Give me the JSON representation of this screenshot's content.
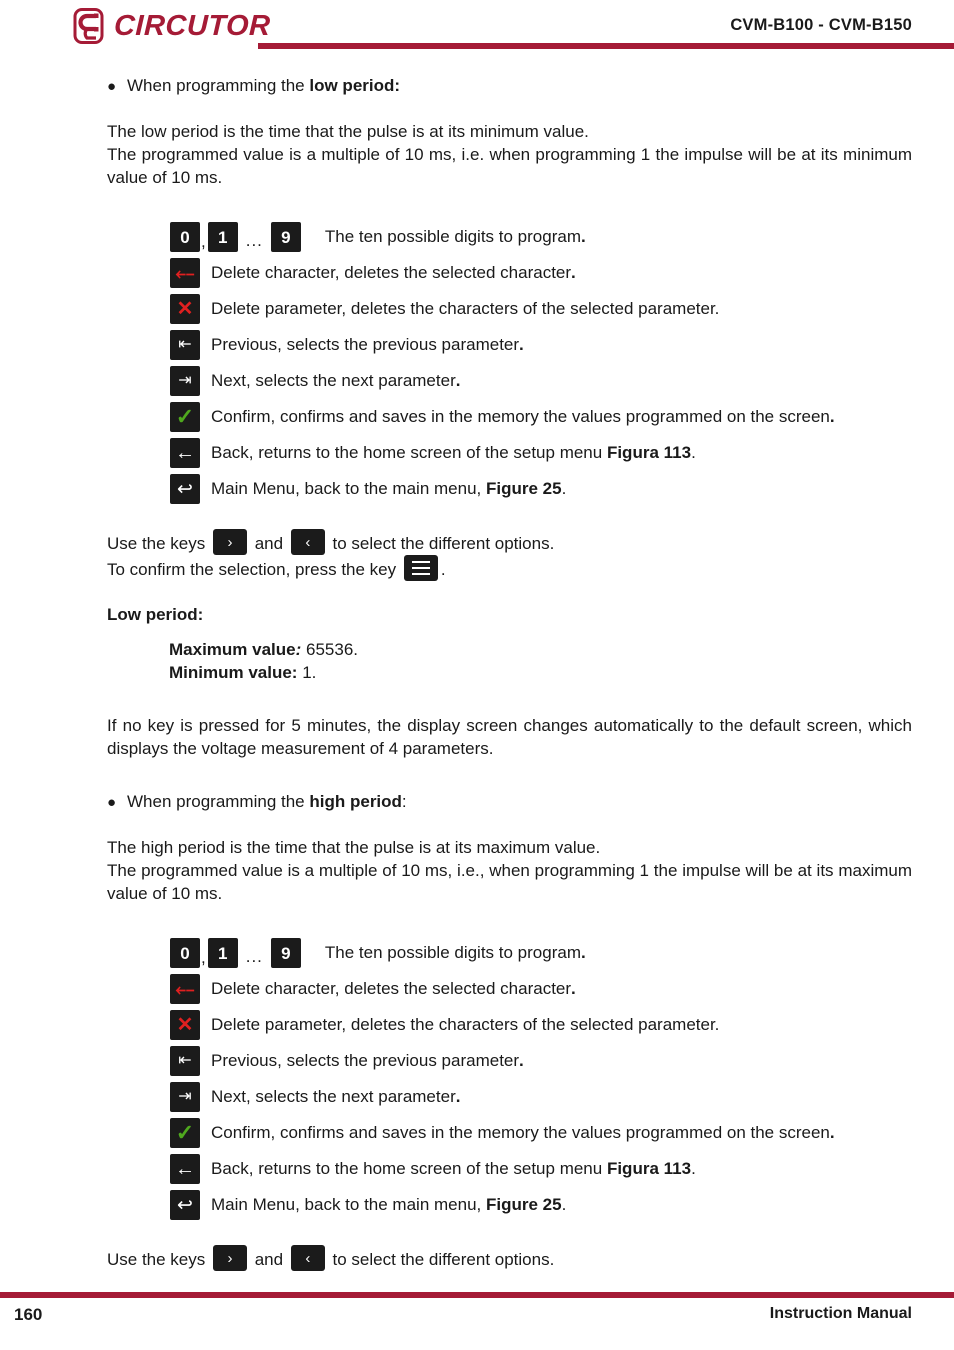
{
  "header": {
    "logo_text": "CIRCUTOR",
    "logo_icon": "circutor-c-logo",
    "title": "CVM-B100 - CVM-B150",
    "rule_color": "#A51B36"
  },
  "footer": {
    "page_number": "160",
    "label": "Instruction Manual",
    "rule_color": "#A51B36"
  },
  "sections": {
    "low": {
      "bullet": "When programming the ",
      "bullet_bold": "low period:",
      "para1": "The low period is the time that the pulse is at its minimum value.",
      "para2": "The programmed value is a multiple of 10 ms, i.e. when programming 1 the impulse will be at its minimum value of 10 ms.",
      "keys": {
        "digit_0": "0",
        "digit_1": "1",
        "digit_9": "9",
        "comma": ",",
        "ellipsis": "...",
        "digits_desc": "The ten possible digits to program",
        "digits_desc_end": ".",
        "del_char_icon": "delete-character-icon",
        "del_char_desc": "Delete character, deletes the selected character",
        "del_char_desc_end": ".",
        "del_param_icon": "delete-parameter-icon",
        "del_param_desc": "Delete parameter, deletes the characters of the selected parameter.",
        "prev_icon": "previous-parameter-icon",
        "prev_desc": "Previous, selects the previous parameter",
        "prev_desc_end": ".",
        "next_icon": "next-parameter-icon",
        "next_desc": "Next, selects the next parameter",
        "next_desc_end": ".",
        "confirm_icon": "confirm-checkmark-icon",
        "confirm_desc": "Confirm, confirms and saves in the memory the values programmed on the screen",
        "confirm_desc_end": ".",
        "back_icon": "back-arrow-icon",
        "back_desc": "Back, returns to the home screen of the setup menu ",
        "back_ref": "Figura 113",
        "back_desc_end": ".",
        "main_icon": "main-menu-return-icon",
        "main_desc": "Main Menu, back to the main menu, ",
        "main_ref": "Figure 25",
        "main_desc_end": "."
      },
      "usekeys": {
        "prefix": "Use the keys ",
        "right_icon": "chevron-right-key-icon",
        "middle": " and ",
        "left_icon": "chevron-left-key-icon",
        "suffix": " to select the different options.",
        "confirm_prefix": "To confirm the selection, press the key ",
        "menu_icon": "menu-hamburger-key-icon",
        "confirm_suffix": "."
      },
      "title": "Low period:",
      "maximum_label": "Maximum value",
      "maximum_colon": ":",
      "maximum_value": " 65536.",
      "minimum_label": "Minimum value:",
      "minimum_value": " 1."
    },
    "timeout_para": "If no key is pressed for 5 minutes, the display screen changes automatically to the default screen, which displays the voltage measurement of 4 parameters.",
    "high": {
      "bullet": "When programming the ",
      "bullet_bold": "high period",
      "bullet_end": ":",
      "para1": "The high period is the time that the pulse is at its maximum value.",
      "para2": "The programmed value is a multiple of 10 ms, i.e., when programming 1 the impulse will be at its maximum value of 10 ms.",
      "keys": {
        "digit_0": "0",
        "digit_1": "1",
        "digit_9": "9",
        "comma": ",",
        "ellipsis": "...",
        "digits_desc": "The ten possible digits to program",
        "digits_desc_end": ".",
        "del_char_desc": "Delete character, deletes the selected character",
        "del_char_desc_end": ".",
        "del_param_desc": "Delete parameter, deletes the characters of the selected parameter.",
        "prev_desc": "Previous, selects the previous parameter",
        "prev_desc_end": ".",
        "next_desc": "Next, selects the next parameter",
        "next_desc_end": ".",
        "confirm_desc": "Confirm, confirms and saves in the memory the values programmed on the screen",
        "confirm_desc_end": ".",
        "back_desc": "Back, returns to the home screen of the setup menu ",
        "back_ref": "Figura 113",
        "back_desc_end": ".",
        "main_desc": "Main Menu, back to the main menu, ",
        "main_ref": "Figure 25",
        "main_desc_end": "."
      },
      "usekeys": {
        "prefix": "Use the keys ",
        "middle": " and ",
        "suffix": " to select the different options."
      }
    }
  }
}
